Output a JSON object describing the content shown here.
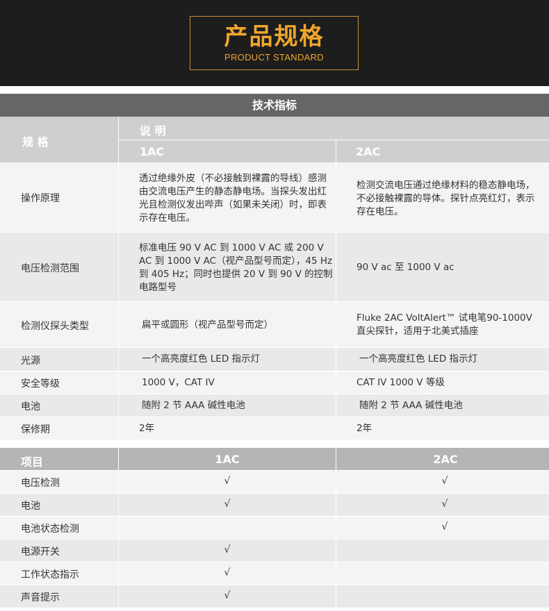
{
  "header": {
    "title_cn": "产品规格",
    "title_en": "PRODUCT STANDARD"
  },
  "spec_table": {
    "title": "技术指标",
    "col_spec": "规 格",
    "col_desc": "说 明",
    "col_1ac": "1AC",
    "col_2ac": "2AC",
    "rows": [
      {
        "label": "操作原理",
        "v1": "透过绝缘外皮（不必接触到裸露的导线）感测由交流电压产生的静态静电场。当探头发出红光且检测仪发出哔声（如果未关闭）时，即表示存在电压。",
        "v2": "检测交流电压通过绝缘材料的稳态静电场，不必接触裸露的导体。探针点亮红灯，表示存在电压。"
      },
      {
        "label": "电压检测范围",
        "v1": "标准电压 90 V AC 到 1000 V AC 或 200 V AC 到 1000 V AC（视产品型号而定），45 Hz 到 405 Hz；同时也提供 20 V 到 90 V 的控制电路型号",
        "v2": "90 V ac 至 1000 V ac"
      },
      {
        "label": "检测仪探头类型",
        "v1": "扁平或圆形（视产品型号而定）",
        "v2": "Fluke 2AC VoltAlert™ 试电笔90-1000V 直尖探针，适用于北美式插座"
      },
      {
        "label": "光源",
        "v1": "一个高亮度红色 LED 指示灯",
        "v2": "一个高亮度红色 LED 指示灯"
      },
      {
        "label": "安全等级",
        "v1": "1000 V，CAT IV",
        "v2": "CAT IV 1000 V 等级"
      },
      {
        "label": "电池",
        "v1": "随附 2 节 AAA 碱性电池",
        "v2": "随附 2 节 AAA 碱性电池"
      },
      {
        "label": "保修期",
        "v1": "2年",
        "v2": "2年"
      }
    ]
  },
  "feature_table": {
    "col_item": "项目",
    "col_1ac": "1AC",
    "col_2ac": "2AC",
    "check": "√",
    "rows": [
      {
        "label": "电压检测",
        "c1": "√",
        "c2": "√"
      },
      {
        "label": "电池",
        "c1": "√",
        "c2": "√"
      },
      {
        "label": "电池状态检测",
        "c1": "",
        "c2": "√"
      },
      {
        "label": "电源开关",
        "c1": "√",
        "c2": ""
      },
      {
        "label": "工作状态指示",
        "c1": "√",
        "c2": ""
      },
      {
        "label": "声音提示",
        "c1": "√",
        "c2": ""
      }
    ]
  }
}
